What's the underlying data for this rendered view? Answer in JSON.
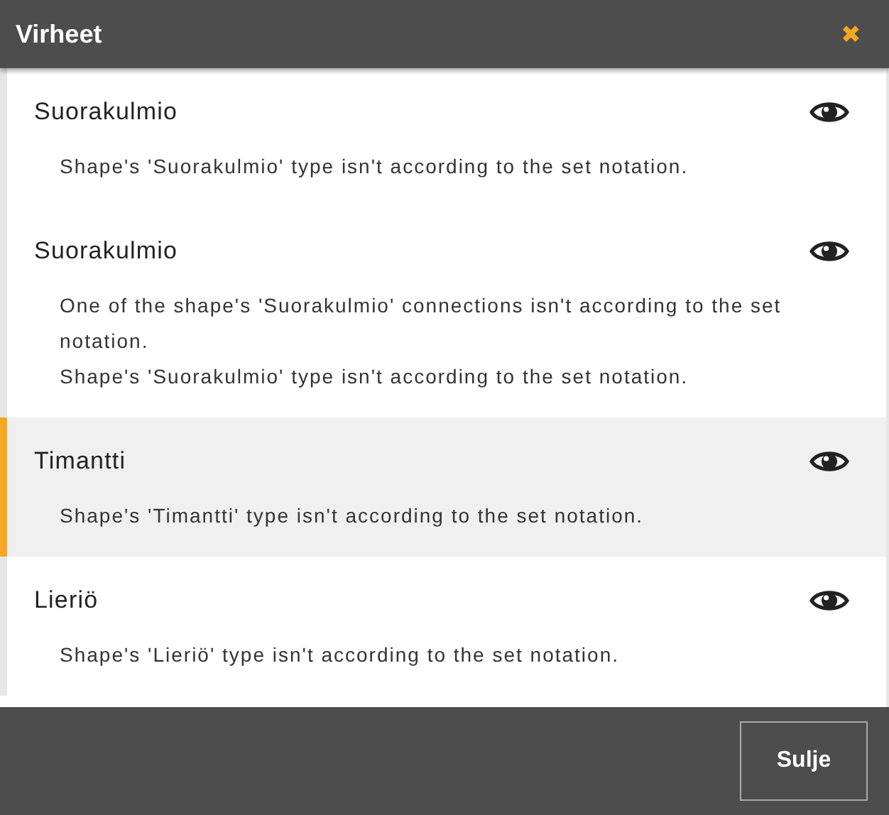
{
  "window": {
    "title": "Virheet",
    "close": "✖"
  },
  "errors": [
    {
      "name": "Suorakulmio",
      "selected": false,
      "messages": [
        "Shape's 'Suorakulmio' type isn't according to the set notation."
      ]
    },
    {
      "name": "Suorakulmio",
      "selected": false,
      "messages": [
        "One of the shape's 'Suorakulmio' connections isn't according to the set notation.",
        "Shape's 'Suorakulmio' type isn't according to the set notation."
      ]
    },
    {
      "name": "Timantti",
      "selected": true,
      "messages": [
        "Shape's 'Timantti' type isn't according to the set notation."
      ]
    },
    {
      "name": "Lieriö",
      "selected": false,
      "messages": [
        "Shape's 'Lieriö' type isn't according to the set notation."
      ]
    }
  ],
  "buttons": [
    "Sulje"
  ]
}
